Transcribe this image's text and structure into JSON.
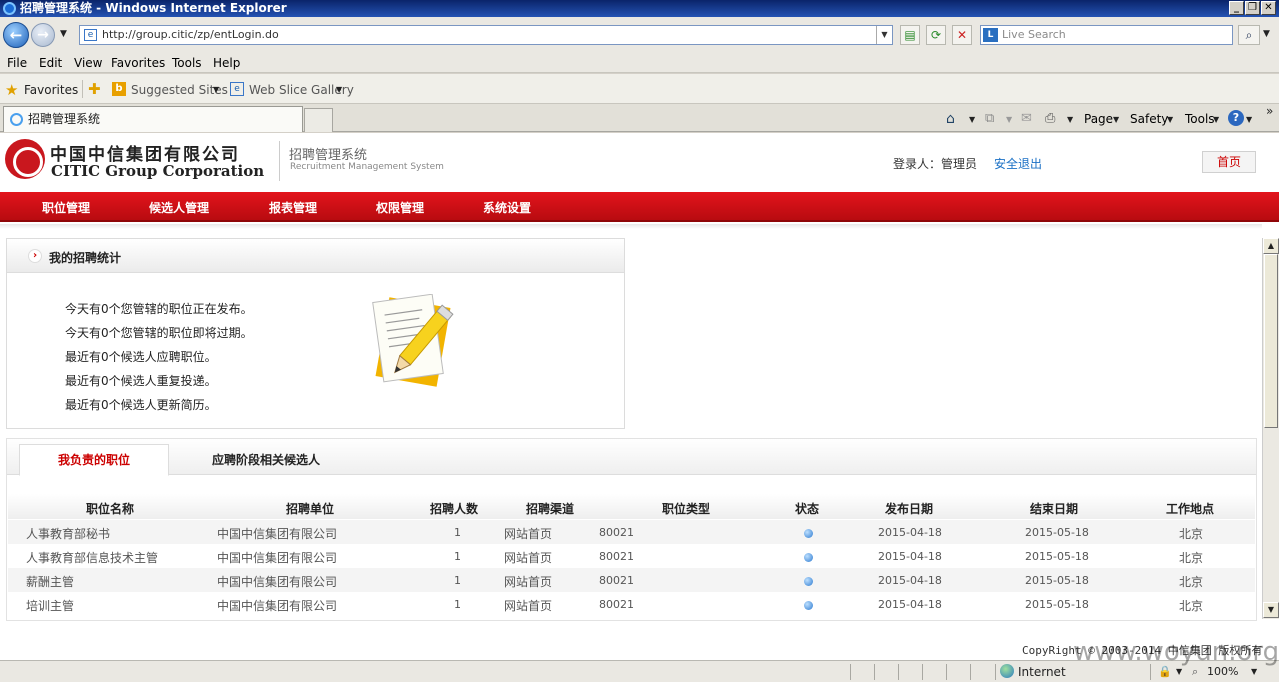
{
  "window": {
    "title": "招聘管理系统 - Windows Internet Explorer",
    "min_icon": "minimize-icon",
    "max_icon": "restore-icon",
    "close_icon": "close-icon"
  },
  "addressbar": {
    "url": "http://group.citic/zp/entLogin.do",
    "search_placeholder": "Live Search"
  },
  "menubar": [
    "File",
    "Edit",
    "View",
    "Favorites",
    "Tools",
    "Help"
  ],
  "favorites_bar": {
    "favorites": "Favorites",
    "suggested": "Suggested Sites",
    "webslice": "Web Slice Gallery"
  },
  "tab": {
    "title": "招聘管理系统"
  },
  "commandbar": {
    "page": "Page",
    "safety": "Safety",
    "tools": "Tools"
  },
  "header": {
    "logo_cn": "中国中信集团有限公司",
    "logo_en": "CITIC Group Corporation",
    "system_cn": "招聘管理系统",
    "system_en": "Recruitment Management System",
    "login_label": "登录人：管理员",
    "logout": "安全退出",
    "home": "首页"
  },
  "nav": [
    "职位管理",
    "候选人管理",
    "报表管理",
    "权限管理",
    "系统设置"
  ],
  "stats": {
    "title": "我的招聘统计",
    "lines": [
      "今天有0个您管辖的职位正在发布。",
      "今天有0个您管辖的职位即将过期。",
      "最近有0个候选人应聘职位。",
      "最近有0个候选人重复投递。",
      "最近有0个候选人更新简历。"
    ]
  },
  "jobs": {
    "tabs": [
      "我负责的职位",
      "应聘阶段相关候选人"
    ],
    "columns": [
      "职位名称",
      "招聘单位",
      "招聘人数",
      "招聘渠道",
      "职位类型",
      "状态",
      "发布日期",
      "结束日期",
      "工作地点"
    ],
    "rows": [
      {
        "name": "人事教育部秘书",
        "unit": "中国中信集团有限公司",
        "count": "1",
        "channel": "网站首页",
        "type": "80021",
        "start": "2015-04-18",
        "end": "2015-05-18",
        "city": "北京"
      },
      {
        "name": "人事教育部信息技术主管",
        "unit": "中国中信集团有限公司",
        "count": "1",
        "channel": "网站首页",
        "type": "80021",
        "start": "2015-04-18",
        "end": "2015-05-18",
        "city": "北京"
      },
      {
        "name": "薪酬主管",
        "unit": "中国中信集团有限公司",
        "count": "1",
        "channel": "网站首页",
        "type": "80021",
        "start": "2015-04-18",
        "end": "2015-05-18",
        "city": "北京"
      },
      {
        "name": "培训主管",
        "unit": "中国中信集团有限公司",
        "count": "1",
        "channel": "网站首页",
        "type": "80021",
        "start": "2015-04-18",
        "end": "2015-05-18",
        "city": "北京"
      }
    ]
  },
  "footer": {
    "copyright": "CopyRight © 2003-2014 中信集团 版权所有"
  },
  "statusbar": {
    "zone": "Internet",
    "zoom": "100%"
  },
  "watermark": "www.woyun.org",
  "colors": {
    "nav_red": "#d4121a",
    "active_tab_red": "#cc0000",
    "link_blue": "#1a70c5"
  }
}
